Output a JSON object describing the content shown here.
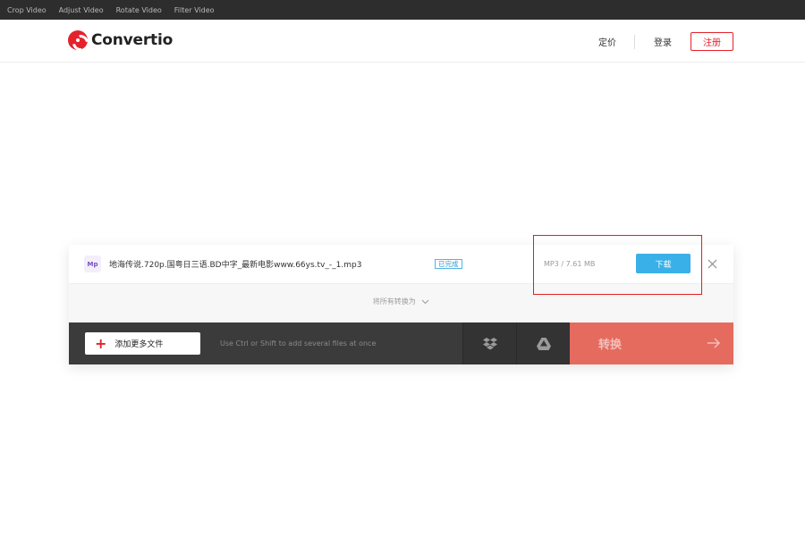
{
  "topbar": {
    "links": [
      "Crop Video",
      "Adjust Video",
      "Rotate Video",
      "Filter Video"
    ]
  },
  "header": {
    "logo_text": "Convertio",
    "nav": {
      "pricing": "定价",
      "login": "登录",
      "register": "注册"
    }
  },
  "file": {
    "type_badge": "Mp",
    "name": "地海传说.720p.国粤日三语.BD中字_最新电影www.66ys.tv_-_1.mp3",
    "status": "已完成",
    "info": "MP3 / 7.61 MB",
    "download_label": "下载"
  },
  "convert_all_label": "将所有转换为",
  "actions": {
    "add_files_label": "添加更多文件",
    "hint": "Use Ctrl or Shift to add several files at once",
    "convert_label": "转换"
  },
  "colors": {
    "brand_red": "#e4222b",
    "download_blue": "#3ab0e8",
    "convert_coral": "#e56b5f",
    "highlight_red": "#e02020"
  },
  "icons": {
    "logo": "convertio-logo-icon",
    "close": "close-icon",
    "add": "plus-icon",
    "dropbox": "dropbox-icon",
    "drive": "google-drive-icon",
    "arrow": "arrow-right-icon",
    "chevron": "chevron-down-icon"
  }
}
